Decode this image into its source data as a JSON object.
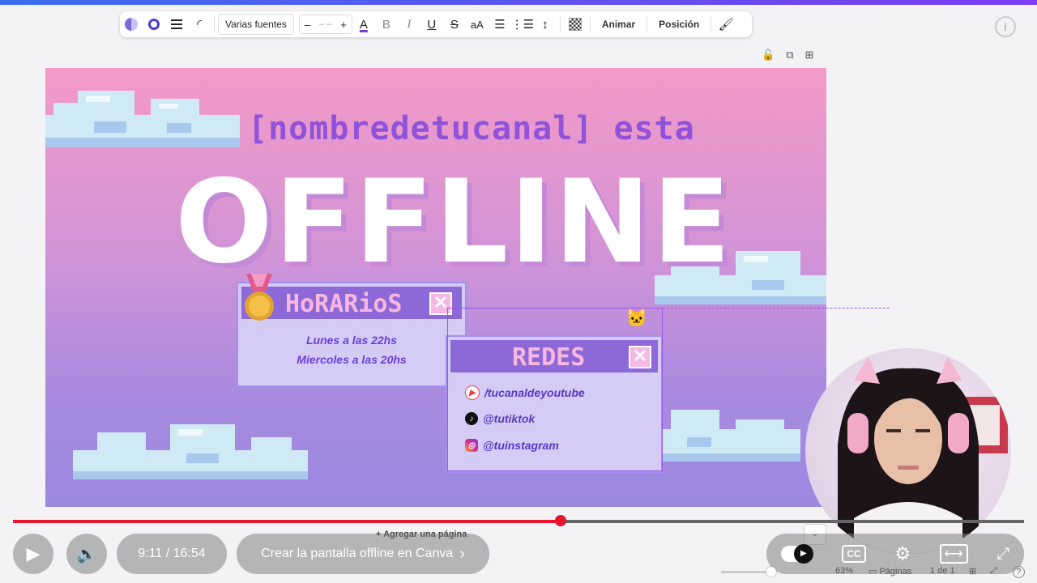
{
  "toolbar": {
    "font_name": "Varias fuentes",
    "size_minus": "–",
    "size_value": "– –",
    "size_plus": "+",
    "text_color": "A",
    "bold": "B",
    "italic": "I",
    "underline": "U",
    "strike": "S",
    "case": "aA",
    "animate": "Animar",
    "position": "Posición"
  },
  "design": {
    "subtitle": "[nombredetucanal] esta",
    "title": "OFFLINE",
    "horarios": {
      "title": "HoRARioS",
      "lines": [
        "Lunes a las 22hs",
        "Miercoles a las 20hs"
      ]
    },
    "redes": {
      "title": "REDES",
      "items": [
        {
          "icon": "youtube-icon",
          "text": "/tucanaldeyoutube"
        },
        {
          "icon": "tiktok-icon",
          "text": "@tutiktok"
        },
        {
          "icon": "instagram-icon",
          "text": "@tuinstagram"
        }
      ]
    },
    "close_glyph": "✕"
  },
  "player": {
    "time": "9:11 / 16:54",
    "chapter": "Crear la pantalla offline en Canva",
    "chapter_chevron": "›",
    "progress_fraction": 0.542,
    "cc": "CC"
  },
  "editor_footer": {
    "add_page": "+ Agregar una página",
    "zoom": "63%",
    "pages": "Páginas",
    "page_count": "1 de 1",
    "help": "?"
  },
  "colors": {
    "accent": "#e8132c",
    "canvas_top": "#f49ac6",
    "canvas_bottom": "#9c88e0",
    "window_header": "#8d69d8"
  }
}
